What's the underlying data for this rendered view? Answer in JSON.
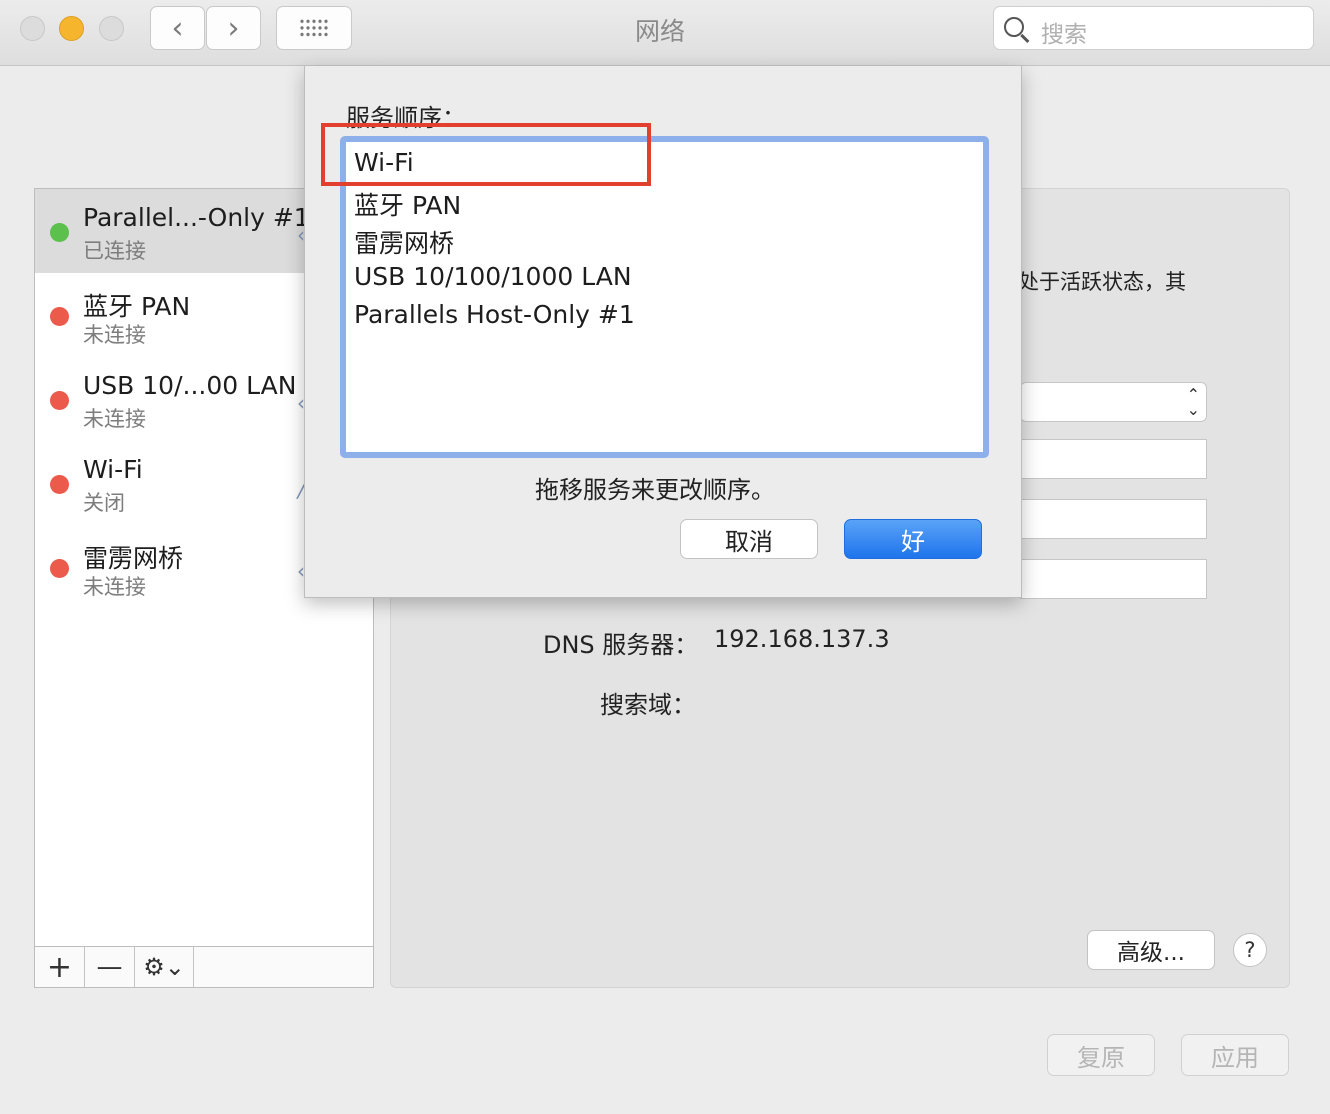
{
  "window": {
    "title": "网络",
    "search_placeholder": "搜索",
    "back_glyph": "‹",
    "forward_glyph": "›"
  },
  "sidebar": {
    "services": [
      {
        "name": "Parallel...-Only #1",
        "status": "已连接",
        "status_color": "#5bc04c",
        "selected": true
      },
      {
        "name": "蓝牙 PAN",
        "status": "未连接",
        "status_color": "#ec5a4c",
        "selected": false
      },
      {
        "name": "USB 10/...00 LAN",
        "status": "未连接",
        "status_color": "#ec5a4c",
        "selected": false
      },
      {
        "name": "Wi-Fi",
        "status": "关闭",
        "status_color": "#ec5a4c",
        "selected": false
      },
      {
        "name": "雷雳网桥",
        "status": "未连接",
        "status_color": "#ec5a4c",
        "selected": false
      }
    ],
    "toolbar": {
      "add": "+",
      "remove": "—",
      "gear": "⚙⌄"
    }
  },
  "detail": {
    "partial_text": "处于活跃状态，其",
    "dns_label": "DNS 服务器：",
    "dns_value": "192.168.137.3",
    "search_domain_label": "搜索域：",
    "advanced_label": "高级...",
    "help_label": "?"
  },
  "footer": {
    "revert_label": "复原",
    "apply_label": "应用"
  },
  "sheet": {
    "title": "服务顺序：",
    "items": [
      "Wi-Fi",
      "蓝牙 PAN",
      "雷雳网桥",
      "USB 10/100/1000 LAN",
      "Parallels Host-Only #1"
    ],
    "hint": "拖移服务来更改顺序。",
    "cancel_label": "取消",
    "ok_label": "好"
  }
}
